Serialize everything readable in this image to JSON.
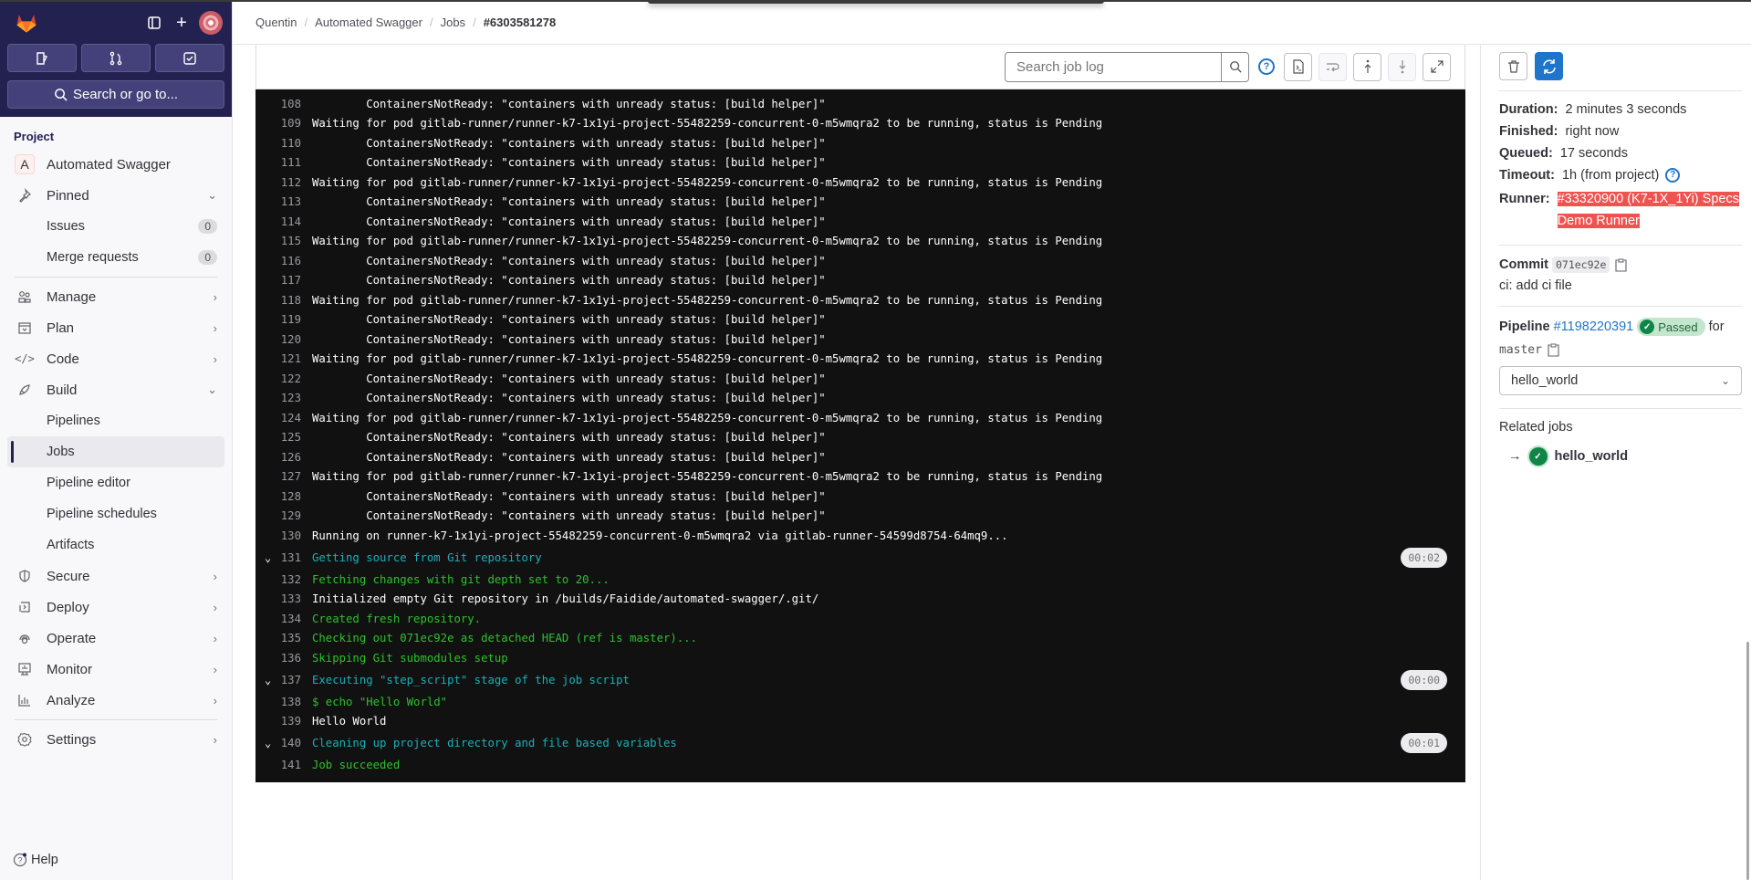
{
  "sidebar": {
    "search_label": "Search or go to...",
    "section_label": "Project",
    "project": {
      "initial": "A",
      "name": "Automated Swagger"
    },
    "pinned": {
      "label": "Pinned",
      "items": [
        {
          "label": "Issues",
          "count": "0"
        },
        {
          "label": "Merge requests",
          "count": "0"
        }
      ]
    },
    "nav": [
      {
        "label": "Manage",
        "icon": "users-icon"
      },
      {
        "label": "Plan",
        "icon": "calendar-icon"
      },
      {
        "label": "Code",
        "icon": "code-icon"
      }
    ],
    "build": {
      "label": "Build",
      "items": [
        {
          "label": "Pipelines"
        },
        {
          "label": "Jobs",
          "selected": true
        },
        {
          "label": "Pipeline editor"
        },
        {
          "label": "Pipeline schedules"
        },
        {
          "label": "Artifacts"
        }
      ]
    },
    "nav2": [
      {
        "label": "Secure",
        "icon": "shield-icon"
      },
      {
        "label": "Deploy",
        "icon": "deploy-icon"
      },
      {
        "label": "Operate",
        "icon": "cloud-icon"
      },
      {
        "label": "Monitor",
        "icon": "monitor-icon"
      },
      {
        "label": "Analyze",
        "icon": "chart-icon"
      }
    ],
    "settings": "Settings",
    "help": "Help"
  },
  "breadcrumb": [
    "Quentin",
    "Automated Swagger",
    "Jobs",
    "#6303581278"
  ],
  "toolbar": {
    "search_placeholder": "Search job log"
  },
  "log": {
    "lines": [
      {
        "n": "108",
        "t": "        ContainersNotReady: \"containers with unready status: [build helper]\"",
        "c": ""
      },
      {
        "n": "109",
        "t": "Waiting for pod gitlab-runner/runner-k7-1x1yi-project-55482259-concurrent-0-m5wmqra2 to be running, status is Pending",
        "c": ""
      },
      {
        "n": "110",
        "t": "        ContainersNotReady: \"containers with unready status: [build helper]\"",
        "c": ""
      },
      {
        "n": "111",
        "t": "        ContainersNotReady: \"containers with unready status: [build helper]\"",
        "c": ""
      },
      {
        "n": "112",
        "t": "Waiting for pod gitlab-runner/runner-k7-1x1yi-project-55482259-concurrent-0-m5wmqra2 to be running, status is Pending",
        "c": ""
      },
      {
        "n": "113",
        "t": "        ContainersNotReady: \"containers with unready status: [build helper]\"",
        "c": ""
      },
      {
        "n": "114",
        "t": "        ContainersNotReady: \"containers with unready status: [build helper]\"",
        "c": ""
      },
      {
        "n": "115",
        "t": "Waiting for pod gitlab-runner/runner-k7-1x1yi-project-55482259-concurrent-0-m5wmqra2 to be running, status is Pending",
        "c": ""
      },
      {
        "n": "116",
        "t": "        ContainersNotReady: \"containers with unready status: [build helper]\"",
        "c": ""
      },
      {
        "n": "117",
        "t": "        ContainersNotReady: \"containers with unready status: [build helper]\"",
        "c": ""
      },
      {
        "n": "118",
        "t": "Waiting for pod gitlab-runner/runner-k7-1x1yi-project-55482259-concurrent-0-m5wmqra2 to be running, status is Pending",
        "c": ""
      },
      {
        "n": "119",
        "t": "        ContainersNotReady: \"containers with unready status: [build helper]\"",
        "c": ""
      },
      {
        "n": "120",
        "t": "        ContainersNotReady: \"containers with unready status: [build helper]\"",
        "c": ""
      },
      {
        "n": "121",
        "t": "Waiting for pod gitlab-runner/runner-k7-1x1yi-project-55482259-concurrent-0-m5wmqra2 to be running, status is Pending",
        "c": ""
      },
      {
        "n": "122",
        "t": "        ContainersNotReady: \"containers with unready status: [build helper]\"",
        "c": ""
      },
      {
        "n": "123",
        "t": "        ContainersNotReady: \"containers with unready status: [build helper]\"",
        "c": ""
      },
      {
        "n": "124",
        "t": "Waiting for pod gitlab-runner/runner-k7-1x1yi-project-55482259-concurrent-0-m5wmqra2 to be running, status is Pending",
        "c": ""
      },
      {
        "n": "125",
        "t": "        ContainersNotReady: \"containers with unready status: [build helper]\"",
        "c": ""
      },
      {
        "n": "126",
        "t": "        ContainersNotReady: \"containers with unready status: [build helper]\"",
        "c": ""
      },
      {
        "n": "127",
        "t": "Waiting for pod gitlab-runner/runner-k7-1x1yi-project-55482259-concurrent-0-m5wmqra2 to be running, status is Pending",
        "c": ""
      },
      {
        "n": "128",
        "t": "        ContainersNotReady: \"containers with unready status: [build helper]\"",
        "c": ""
      },
      {
        "n": "129",
        "t": "        ContainersNotReady: \"containers with unready status: [build helper]\"",
        "c": ""
      },
      {
        "n": "130",
        "t": "Running on runner-k7-1x1yi-project-55482259-concurrent-0-m5wmqra2 via gitlab-runner-54599d8754-64mq9...",
        "c": ""
      },
      {
        "n": "131",
        "t": "Getting source from Git repository",
        "c": "c-c",
        "section": true,
        "duration": "00:02"
      },
      {
        "n": "132",
        "t": "Fetching changes with git depth set to 20...",
        "c": "c-g"
      },
      {
        "n": "133",
        "t": "Initialized empty Git repository in /builds/Faidide/automated-swagger/.git/",
        "c": ""
      },
      {
        "n": "134",
        "t": "Created fresh repository.",
        "c": "c-g"
      },
      {
        "n": "135",
        "t": "Checking out 071ec92e as detached HEAD (ref is master)...",
        "c": "c-g"
      },
      {
        "n": "136",
        "t": "Skipping Git submodules setup",
        "c": "c-g"
      },
      {
        "n": "137",
        "t": "Executing \"step_script\" stage of the job script",
        "c": "c-c",
        "section": true,
        "duration": "00:00"
      },
      {
        "n": "138",
        "t": "$ echo \"Hello World\"",
        "c": "c-g"
      },
      {
        "n": "139",
        "t": "Hello World",
        "c": ""
      },
      {
        "n": "140",
        "t": "Cleaning up project directory and file based variables",
        "c": "c-c",
        "section": true,
        "duration": "00:01"
      },
      {
        "n": "141",
        "t": "Job succeeded",
        "c": "c-g"
      }
    ]
  },
  "job": {
    "duration_label": "Duration:",
    "duration": "2 minutes 3 seconds",
    "finished_label": "Finished:",
    "finished": "right now",
    "queued_label": "Queued:",
    "queued": "17 seconds",
    "timeout_label": "Timeout:",
    "timeout": "1h (from project)",
    "runner_label": "Runner:",
    "runner": "#33320900 (K7-1X_1Yi) Specs Demo Runner",
    "commit_label": "Commit",
    "commit_sha": "071ec92e",
    "commit_msg": "ci: add ci file",
    "pipeline_label": "Pipeline",
    "pipeline_id": "#1198220391",
    "pipeline_status": "Passed",
    "for_label": "for",
    "branch": "master",
    "stage_select": "hello_world",
    "related_label": "Related jobs",
    "related_job": "hello_world"
  },
  "colors": {
    "accent": "#1f75cb",
    "sidebar_dark": "#232150",
    "success": "#108548",
    "runner_highlight": "#ef5350"
  }
}
